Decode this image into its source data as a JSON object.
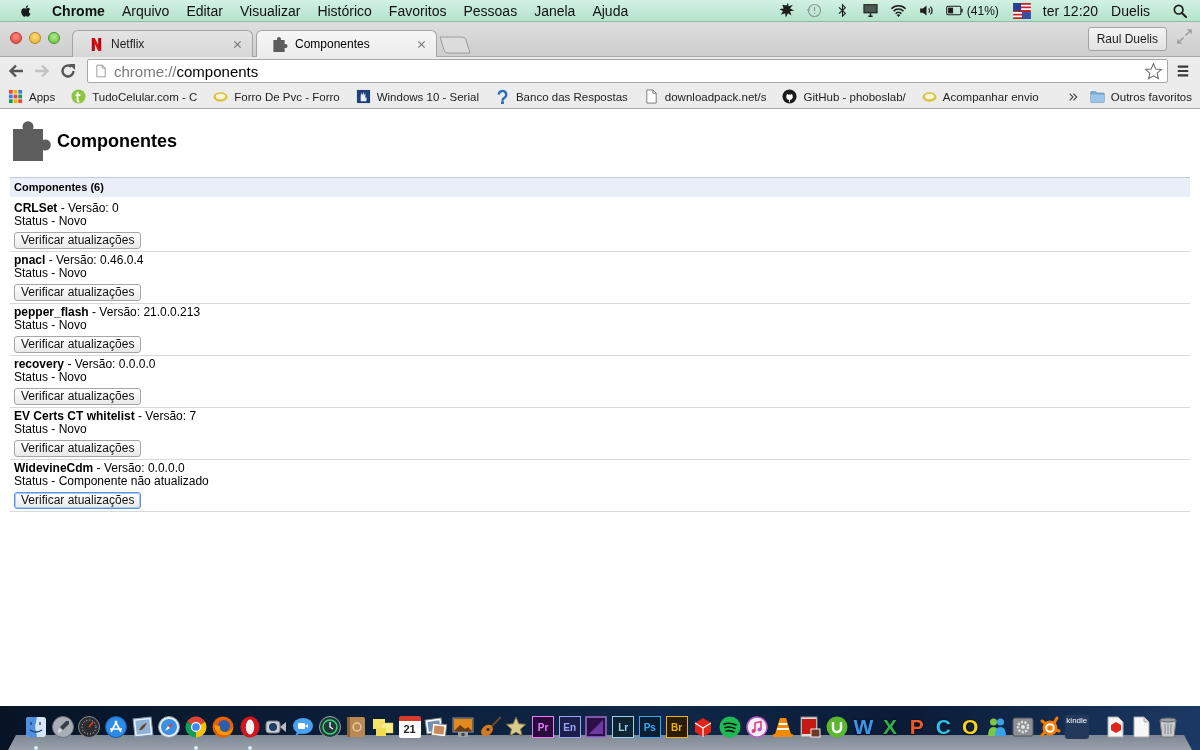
{
  "menu_bar": {
    "app_name": "Chrome",
    "menus": [
      "Arquivo",
      "Editar",
      "Visualizar",
      "Histórico",
      "Favoritos",
      "Pessoas",
      "Janela",
      "Ajuda"
    ],
    "battery_text": "(41%)",
    "clock": "ter 12:20",
    "user": "Duelis"
  },
  "tabs": [
    {
      "title": "Netflix",
      "selected": false
    },
    {
      "title": "Componentes",
      "selected": true
    }
  ],
  "profile_button": "Raul Duelis",
  "navigation": {
    "back": {
      "disabled": false
    },
    "forward": {
      "disabled": true
    }
  },
  "address": {
    "scheme": "chrome://",
    "host": "components"
  },
  "bookmarks": [
    {
      "title": "Apps"
    },
    {
      "title": "TudoCelular.com - C"
    },
    {
      "title": "Forro De Pvc - Forro"
    },
    {
      "title": "Windows 10 - Serial"
    },
    {
      "title": "Banco das Respostas"
    },
    {
      "title": "downloadpack.net/s"
    },
    {
      "title": "GitHub - phoboslab/"
    },
    {
      "title": "Acompanhar envio"
    }
  ],
  "other_bookmarks": "Outros favoritos",
  "page": {
    "title": "Componentes",
    "section_title": "Componentes (6)",
    "components": [
      {
        "title": "**CRLSet** - Versão: 0",
        "status": "Status - Novo",
        "button": "Verificar atualizações",
        "focused": false
      },
      {
        "title": "**pnacl** - Versão: 0.46.0.4",
        "status": "Status - Novo",
        "button": "Verificar atualizações",
        "focused": false
      },
      {
        "title": "**pepper_flash** - Versão: 21.0.0.213",
        "status": "Status - Novo",
        "button": "Verificar atualizações",
        "focused": false
      },
      {
        "title": "**recovery** - Versão: 0.0.0.0",
        "status": "Status - Novo",
        "button": "Verificar atualizações",
        "focused": false
      },
      {
        "title": "**EV Certs CT whitelist** - Versão: 7",
        "status": "Status - Novo",
        "button": "Verificar atualizações",
        "focused": false
      },
      {
        "title": "**WidevineCdm** - Versão: 0.0.0.0",
        "status": "Status - Componente não atualizado",
        "button": "Verificar atualizações",
        "focused": true
      }
    ]
  },
  "dock": {
    "apps": [
      {
        "kind": "icon",
        "running": true
      },
      {
        "kind": "icon",
        "running": false
      },
      {
        "kind": "icon",
        "running": false
      },
      {
        "kind": "icon",
        "running": false
      },
      {
        "kind": "icon",
        "running": false
      },
      {
        "kind": "icon",
        "running": false
      },
      {
        "kind": "icon",
        "running": true
      },
      {
        "kind": "icon",
        "running": false
      },
      {
        "kind": "icon",
        "running": true
      },
      {
        "kind": "icon",
        "running": false
      },
      {
        "kind": "icon",
        "running": false
      },
      {
        "kind": "icon",
        "running": false
      },
      {
        "kind": "icon",
        "running": false
      },
      {
        "kind": "icon",
        "running": false
      },
      {
        "kind": "calendar",
        "text": "21",
        "running": false
      },
      {
        "kind": "icon",
        "running": false
      },
      {
        "kind": "icon",
        "running": false
      },
      {
        "kind": "icon",
        "running": false
      },
      {
        "kind": "icon",
        "running": false
      },
      {
        "kind": "tile",
        "text": "Pr",
        "running": false
      },
      {
        "kind": "tile",
        "text": "En",
        "running": false
      },
      {
        "kind": "icon",
        "running": false
      },
      {
        "kind": "tile",
        "text": "Lr",
        "running": false
      },
      {
        "kind": "tile",
        "text": "Ps",
        "running": false
      },
      {
        "kind": "tile",
        "text": "Br",
        "running": false
      },
      {
        "kind": "icon",
        "running": false
      },
      {
        "kind": "icon",
        "running": false
      },
      {
        "kind": "icon",
        "running": false
      },
      {
        "kind": "icon",
        "running": false
      },
      {
        "kind": "icon",
        "running": false
      },
      {
        "kind": "icon",
        "running": false
      },
      {
        "kind": "glyph",
        "text": "W",
        "running": false
      },
      {
        "kind": "glyph",
        "text": "X",
        "running": false
      },
      {
        "kind": "glyph",
        "text": "P",
        "running": false
      },
      {
        "kind": "glyph",
        "text": "C",
        "running": false
      },
      {
        "kind": "glyph",
        "text": "O",
        "running": false
      },
      {
        "kind": "icon",
        "running": false
      },
      {
        "kind": "icon",
        "running": false
      },
      {
        "kind": "icon",
        "running": false
      },
      {
        "kind": "label",
        "text": "kindle",
        "running": false
      }
    ],
    "stacks": [
      {
        "kind": "icon"
      },
      {
        "kind": "icon"
      },
      {
        "kind": "icon"
      }
    ]
  }
}
